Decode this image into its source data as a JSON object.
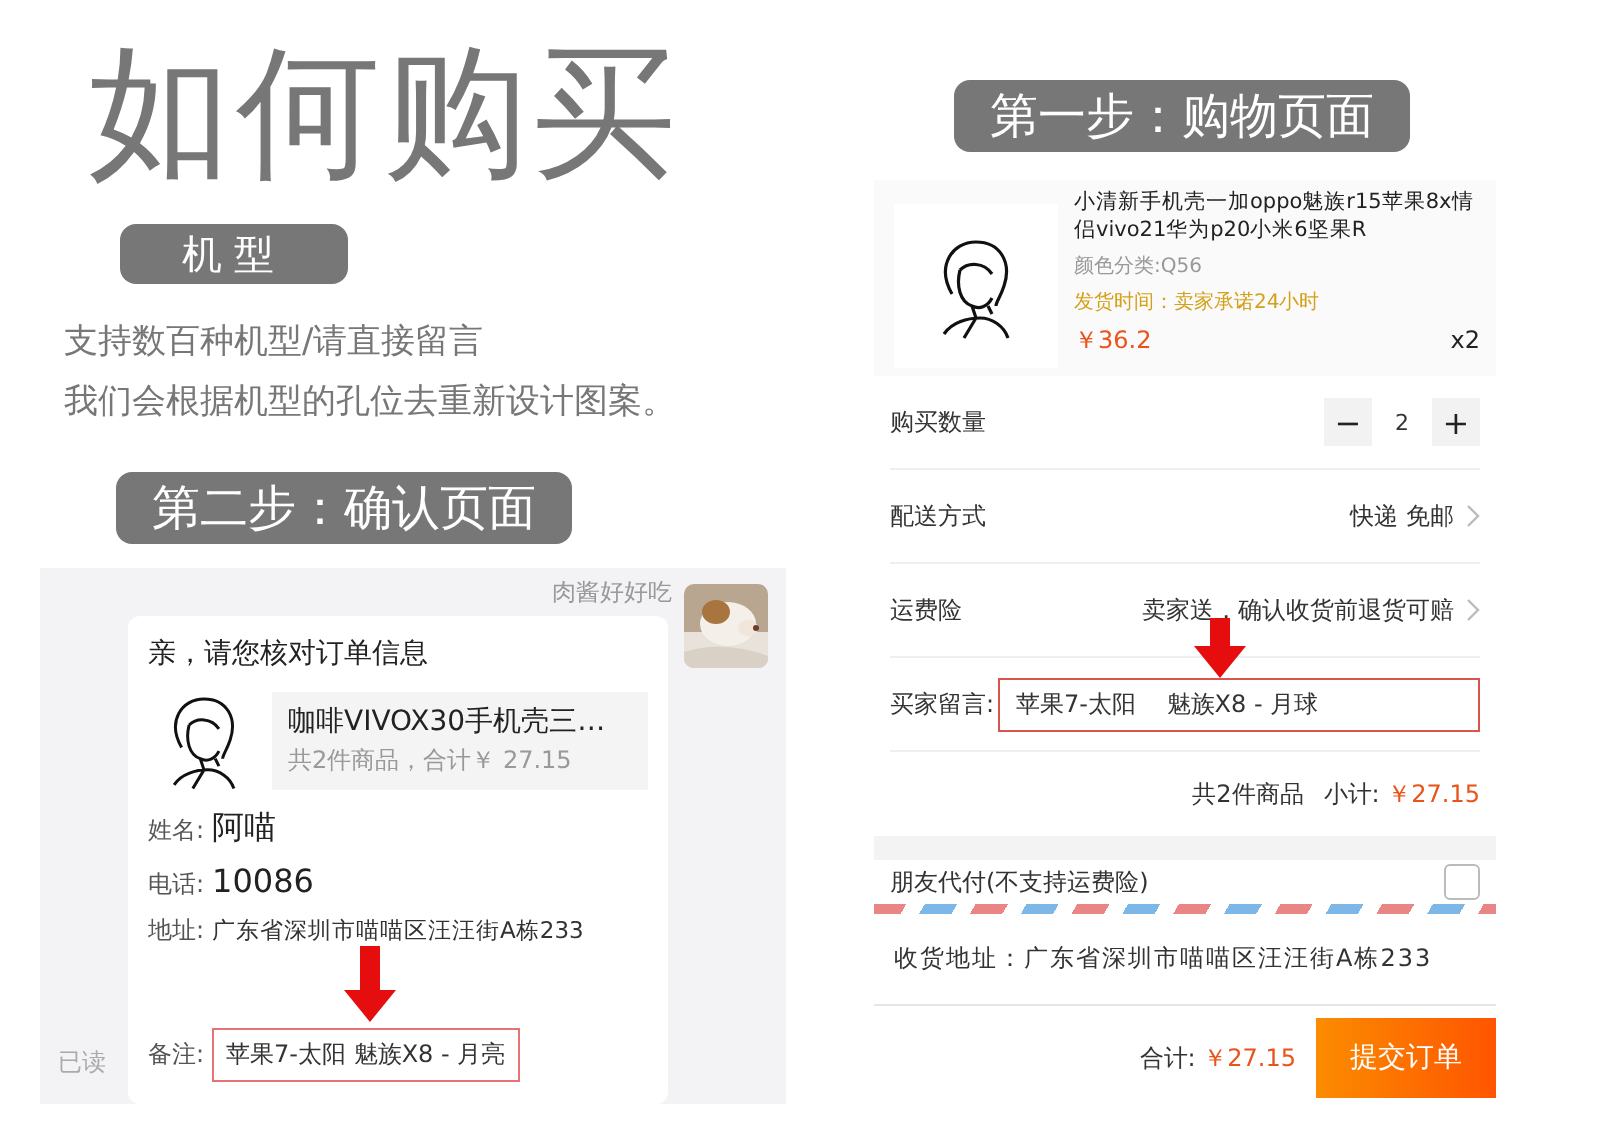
{
  "title": "如何购买",
  "model_tag": "机型",
  "notes": [
    "支持数百种机型/请直接留言",
    "我们会根据机型的孔位去重新设计图案。"
  ],
  "step2": {
    "label": "第二步：确认页面",
    "chat": {
      "sender": "肉酱好好吃",
      "read": "已读",
      "card_title": "亲，请您核对订单信息",
      "product_name": "咖啡VIVOX30手机壳三…",
      "product_summary": "共2件商品，合计￥ 27.15",
      "fields": [
        {
          "label": "姓名:",
          "value": "阿喵",
          "kind": "large"
        },
        {
          "label": "电话:",
          "value": "10086",
          "kind": "large"
        },
        {
          "label": "地址:",
          "value": "广东省深圳市喵喵区汪汪街A栋233",
          "kind": "small"
        }
      ],
      "note": {
        "label": "备注:",
        "value": "苹果7-太阳  魅族X8 - 月亮"
      }
    }
  },
  "step1": {
    "label": "第一步：购物页面",
    "product": {
      "name": "小清新手机壳一加oppo魅族r15苹果8x情侣vivo21华为p20小米6坚果R",
      "variant": "颜色分类:Q56",
      "shipping": "发货时间：卖家承诺24小时",
      "price": "￥36.2",
      "qty": "x2"
    },
    "quantity": {
      "label": "购买数量",
      "minus": "−",
      "value": "2",
      "plus": "+"
    },
    "rows": [
      {
        "label": "配送方式",
        "value": "快递 免邮"
      },
      {
        "label": "运费险",
        "value": "卖家送，确认收货前退货可赔"
      }
    ],
    "message": {
      "label": "买家留言:",
      "value": "苹果7-太阳    魅族X8 - 月球"
    },
    "subtotal": {
      "count": "共2件商品",
      "label": "小计:",
      "amount": "￥27.15"
    },
    "pay_friend": {
      "label": "朋友代付(不支持运费险)",
      "checked": false
    },
    "address": "收货地址：广东省深圳市喵喵区汪汪街A栋233",
    "total": {
      "label": "合计:",
      "amount": "￥27.15"
    },
    "submit": "提交订单"
  }
}
